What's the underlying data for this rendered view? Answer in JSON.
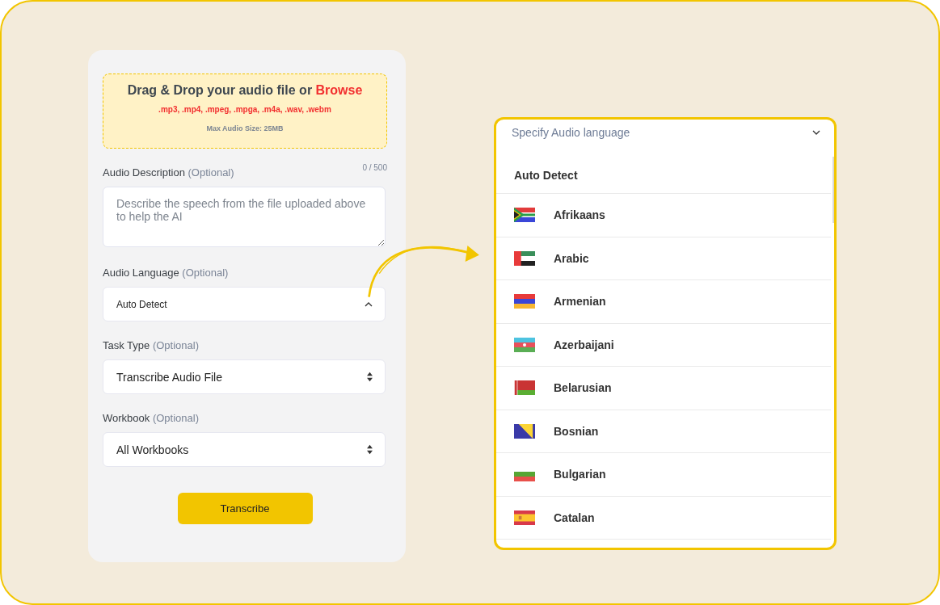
{
  "upload": {
    "title": "Drag & Drop your audio file or ",
    "link": "Browse",
    "formats": ".mp3, .mp4, .mpeg, .mpga, .m4a, .wav, .webm",
    "limit": "Max Audio Size: 25MB"
  },
  "fields": [
    {
      "kind": "textarea",
      "label": "Audio Description",
      "hint": "(Optional)",
      "counter": "0 / 500",
      "placeholder": "Describe the speech from the file uploaded above to help the AI"
    },
    {
      "kind": "combo",
      "label": "Audio Language",
      "hint": "(Optional)",
      "value": "Auto Detect",
      "expanded": true
    },
    {
      "kind": "select",
      "label": "Task Type",
      "hint": "(Optional)",
      "value": "Transcribe Audio File"
    },
    {
      "kind": "select",
      "label": "Workbook",
      "hint": "(Optional)",
      "value": "All Workbooks"
    }
  ],
  "submit": "Transcribe",
  "language_menu": {
    "placeholder": "Specify Audio language",
    "expanded": true,
    "items": [
      {
        "label": "Auto Detect",
        "kind": "none"
      },
      {
        "label": "Afrikaans",
        "kind": "za"
      },
      {
        "label": "Arabic",
        "kind": "ae"
      },
      {
        "label": "Armenian",
        "kind": "am"
      },
      {
        "label": "Azerbaijani",
        "kind": "az"
      },
      {
        "label": "Belarusian",
        "kind": "by"
      },
      {
        "label": "Bosnian",
        "kind": "ba"
      },
      {
        "label": "Bulgarian",
        "kind": "bg"
      },
      {
        "label": "Catalan",
        "kind": "es"
      }
    ]
  }
}
